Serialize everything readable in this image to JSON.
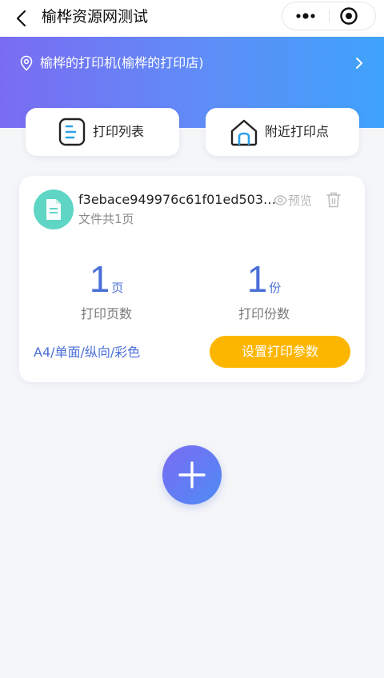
{
  "nav": {
    "title": "榆桦资源网测试",
    "back_icon": "chevron-left-icon",
    "more_icon": "more-dots-icon",
    "target_icon": "target-icon"
  },
  "header": {
    "location_icon": "location-pin-icon",
    "printer": "榆桦的打印机(榆桦的打印店)",
    "arrow_icon": "chevron-right-icon",
    "gradient_start": "#7a6cf2",
    "gradient_end": "#3fa3fb"
  },
  "quick_actions": [
    {
      "label": "打印列表",
      "icon": "document-list-icon"
    },
    {
      "label": "附近打印点",
      "icon": "house-icon"
    }
  ],
  "file_card": {
    "file_icon": "file-icon",
    "file_name": "f3ebace949976c61f01ed503…",
    "page_info": "文件共1页",
    "preview_label": "预览",
    "preview_icon": "eye-icon",
    "delete_icon": "trash-icon",
    "pages": {
      "value": "1",
      "unit": "页",
      "caption": "打印页数"
    },
    "copies": {
      "value": "1",
      "unit": "份",
      "caption": "打印份数"
    },
    "spec": "A4/单面/纵向/彩色",
    "settings_button": "设置打印参数",
    "accent_color": "#4a6fd8",
    "button_color": "#fdb600"
  },
  "fab": {
    "icon": "plus-icon"
  }
}
